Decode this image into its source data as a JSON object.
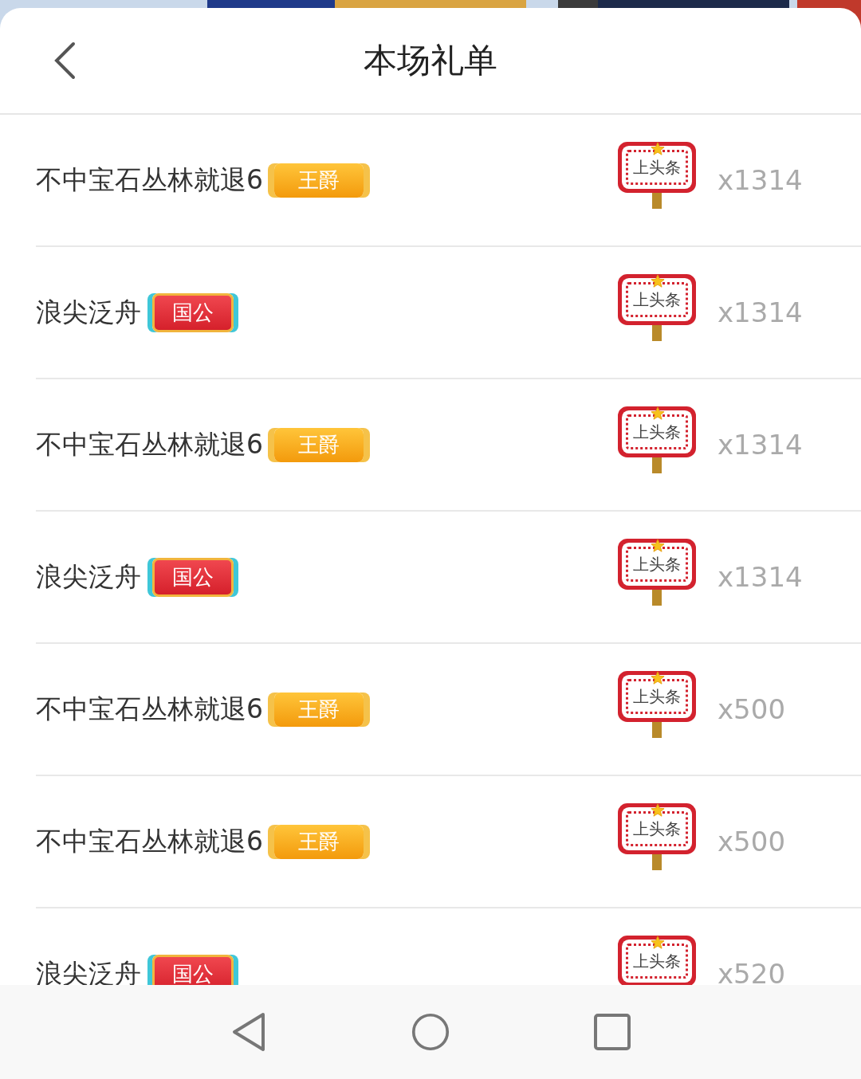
{
  "header": {
    "title": "本场礼单"
  },
  "rows": [
    {
      "name": "不中宝石丛林就退6",
      "badge": {
        "kind": "gold",
        "label": "王爵"
      },
      "gift": "上头条",
      "count": "x1314"
    },
    {
      "name": "浪尖泛舟",
      "badge": {
        "kind": "red",
        "label": "国公"
      },
      "gift": "上头条",
      "count": "x1314"
    },
    {
      "name": "不中宝石丛林就退6",
      "badge": {
        "kind": "gold",
        "label": "王爵"
      },
      "gift": "上头条",
      "count": "x1314"
    },
    {
      "name": "浪尖泛舟",
      "badge": {
        "kind": "red",
        "label": "国公"
      },
      "gift": "上头条",
      "count": "x1314"
    },
    {
      "name": "不中宝石丛林就退6",
      "badge": {
        "kind": "gold",
        "label": "王爵"
      },
      "gift": "上头条",
      "count": "x500"
    },
    {
      "name": "不中宝石丛林就退6",
      "badge": {
        "kind": "gold",
        "label": "王爵"
      },
      "gift": "上头条",
      "count": "x500"
    },
    {
      "name": "浪尖泛舟",
      "badge": {
        "kind": "red",
        "label": "国公"
      },
      "gift": "上头条",
      "count": "x520"
    }
  ]
}
